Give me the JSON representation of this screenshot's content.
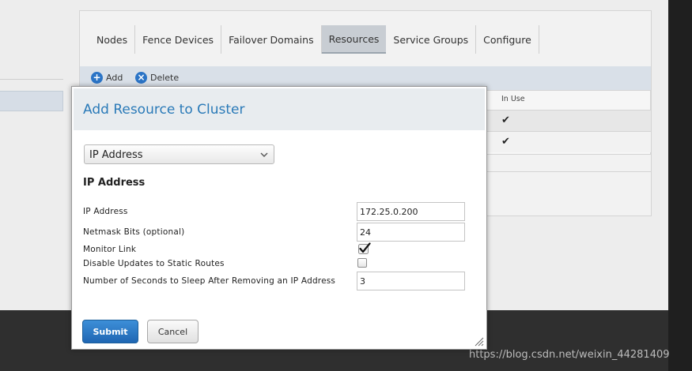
{
  "background": {
    "tabs": [
      {
        "label": "Nodes",
        "active": false
      },
      {
        "label": "Fence Devices",
        "active": false
      },
      {
        "label": "Failover Domains",
        "active": false
      },
      {
        "label": "Resources",
        "active": true
      },
      {
        "label": "Service Groups",
        "active": false
      },
      {
        "label": "Configure",
        "active": false
      }
    ],
    "toolbar": {
      "add_label": "Add",
      "delete_label": "Delete"
    },
    "table": {
      "in_use_header": "In Use"
    }
  },
  "modal": {
    "title": "Add Resource to Cluster",
    "resource_type": {
      "selected": "IP Address"
    },
    "section_title": "IP Address",
    "fields": {
      "ip_address": {
        "label": "IP Address",
        "value": "172.25.0.200"
      },
      "netmask_bits": {
        "label": "Netmask Bits (optional)",
        "value": "24"
      },
      "monitor_link": {
        "label": "Monitor Link",
        "checked": true
      },
      "disable_updates": {
        "label": "Disable Updates to Static Routes",
        "checked": false
      },
      "sleep_seconds": {
        "label": "Number of Seconds to Sleep After Removing an IP Address",
        "value": "3"
      }
    },
    "submit_label": "Submit",
    "cancel_label": "Cancel"
  },
  "watermark": "https://blog.csdn.net/weixin_44281409",
  "colors": {
    "title_blue": "#2a7ab8",
    "submit_blue": "#1f66b3",
    "overlay": "#2f2f2f"
  }
}
